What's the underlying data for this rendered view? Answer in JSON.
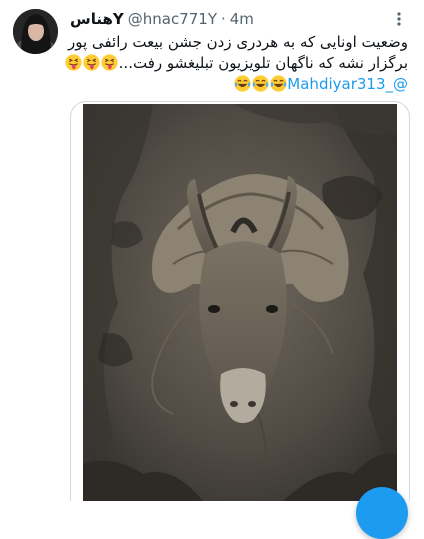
{
  "tweet": {
    "display_name": "هناسY",
    "handle": "@hnac771Y",
    "separator": "·",
    "time": "4m",
    "text_line1": "وضعیت اونایی که به هردری زدن جشن بیعت رائفی پور",
    "text_line2": "برگزار نشه که ناگهان  تلویزیون تبلیغشو رفت...",
    "mention": "@_Mahdiyar313",
    "icons": {
      "more": "three-dots-vertical",
      "line2_emojis": [
        "squinting-tongue-face",
        "squinting-tongue-face",
        "squinting-tongue-face"
      ],
      "line3_emojis": [
        "tears-of-joy-face",
        "tears-of-joy-face",
        "tears-of-joy-face"
      ]
    }
  },
  "colors": {
    "link": "#1d9bf0",
    "secondary_text": "#536471",
    "border": "#cfd9de",
    "fab": "#1d9bf0"
  }
}
